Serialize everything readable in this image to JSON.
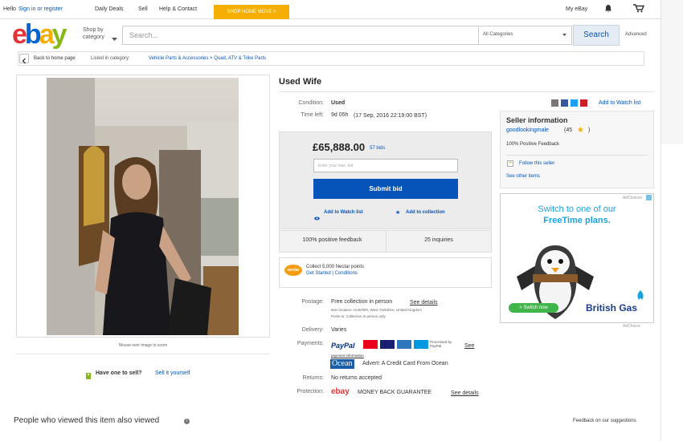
{
  "topbar": {
    "hello": "Hello",
    "sign_in": "Sign in or register",
    "daily_deals": "Daily Deals",
    "sell": "Sell",
    "help": "Help & Contact",
    "promo": "SHOP HOME MOVE >",
    "my_ebay": "My eBay"
  },
  "header": {
    "logo": [
      "e",
      "b",
      "a",
      "y"
    ],
    "shop_by": "Shop by",
    "category": "category",
    "search_placeholder": "Search...",
    "category_select": "All Categories",
    "search_button": "Search",
    "advanced": "Advanced"
  },
  "breadcrumb": {
    "back": "Back to home page",
    "listed": "Listed in category:",
    "path": "Vehicle Parts & Accessories > Quad, ATV & Trike Parts"
  },
  "image": {
    "hint": "Mouse over image to zoom"
  },
  "sell": {
    "question": "Have one to sell?",
    "link": "Sell it yourself"
  },
  "item": {
    "title": "Used Wife",
    "condition_label": "Condition:",
    "condition": "Used",
    "time_label": "Time left:",
    "time_left": "9d 05h",
    "time_detail": "(17 Sep, 2016   22:19:00 BST)",
    "price": "£65,888.00",
    "bids": "57 bids",
    "bid_placeholder": "Enter your max. bid",
    "submit": "Submit bid",
    "watch": "Add to Watch list",
    "collection": "Add to collection",
    "positive": "100% positive feedback",
    "enquiries": "25 inquiries"
  },
  "nectar": {
    "collect": "Collect 5,000 Nectar points",
    "links": "Get Started | Conditions"
  },
  "social": {
    "add_watch": "Add to Watch list"
  },
  "seller": {
    "heading": "Seller information",
    "name": "goodlookingmale",
    "score": "(45",
    "score_close": ")",
    "feedback": "100% Positive Feedback",
    "follow": "Follow this seller",
    "see_other": "See other items"
  },
  "ad": {
    "adchoices": "AdChoices",
    "headline1": "Switch to one of our",
    "headline2": "FreeTime plans.",
    "button": "> Switch now",
    "brand": "British Gas",
    "footer": "AdChoice"
  },
  "details": {
    "postage_label": "Postage:",
    "postage": "Free collection in person",
    "see_details": "See details",
    "item_location": "Item location:  Holmfirth, West Yorkshire, United Kingdom",
    "posts_to": "Posts to:  Collection in person only",
    "delivery_label": "Delivery:",
    "delivery": "Varies",
    "payments_label": "Payments:",
    "paypal": "PayPal",
    "processed": "Processed by PayPal",
    "see": "See",
    "payment_info": "payment information",
    "ocean": "Ocean",
    "ocean_ad": "Advert: A Credit Card From Ocean",
    "returns_label": "Returns:",
    "returns": "No returns accepted",
    "protection_label": "Protection:",
    "protection_logo": "ebay",
    "guarantee": "MONEY BACK GUARANTEE",
    "guarantee_link": "See details"
  },
  "footer": {
    "also_viewed": "People who viewed this item also viewed",
    "feedback": "Feedback on our suggestions"
  }
}
